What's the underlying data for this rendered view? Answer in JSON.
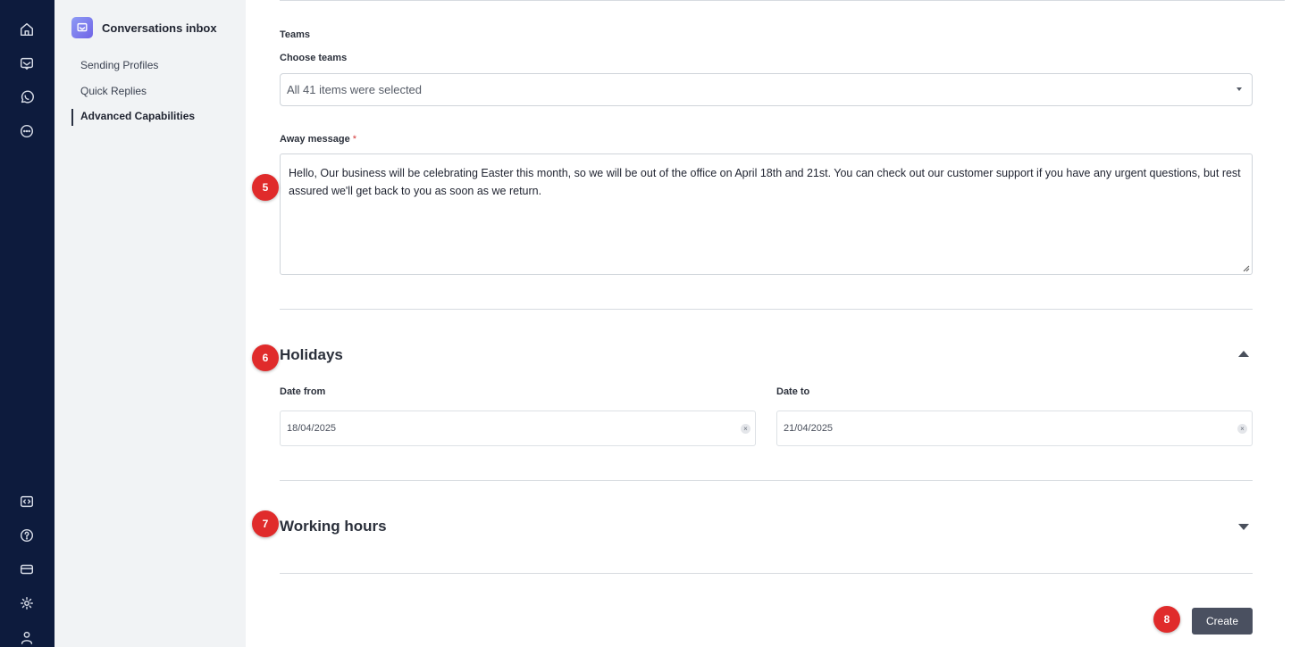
{
  "sidebar": {
    "app_title": "Conversations inbox",
    "items": [
      {
        "label": "Sending Profiles"
      },
      {
        "label": "Quick Replies"
      },
      {
        "label": "Advanced Capabilities"
      }
    ]
  },
  "rail": {
    "top_icons": [
      "home-icon",
      "inbox-icon",
      "whatsapp-icon",
      "chat-bubble-icon"
    ],
    "bottom_icons": [
      "code-icon",
      "help-icon",
      "billing-card-icon",
      "settings-icon",
      "user-icon"
    ]
  },
  "teams": {
    "section_label": "Teams",
    "field_label": "Choose teams",
    "selected_value": "All 41 items were selected"
  },
  "away_message": {
    "label": "Away message",
    "required_mark": "*",
    "value": "Hello, Our business will be celebrating Easter this month, so we will be out of the office on April 18th and 21st. You can check out our customer support if you have any urgent questions, but rest assured we'll get back to you as soon as we return."
  },
  "holidays": {
    "title": "Holidays",
    "expanded": true,
    "date_from_label": "Date from",
    "date_from_value": "18/04/2025",
    "date_to_label": "Date to",
    "date_to_value": "21/04/2025",
    "clear_glyph": "×"
  },
  "working_hours": {
    "title": "Working hours",
    "expanded": false
  },
  "actions": {
    "create_label": "Create"
  },
  "markers": [
    "5",
    "6",
    "7",
    "8"
  ],
  "colors": {
    "rail_bg": "#0d1b3d",
    "subnav_bg": "#f1f3f5",
    "marker": "#e02b2b",
    "primary_button": "#4a5060",
    "required": "#d33a3a"
  }
}
